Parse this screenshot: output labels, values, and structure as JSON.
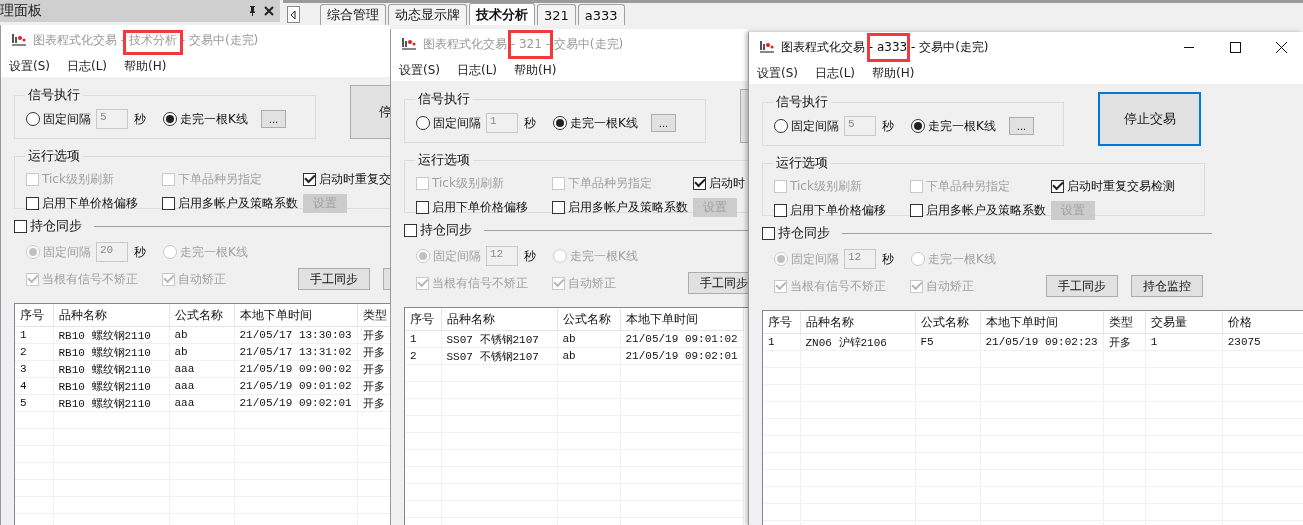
{
  "panel": {
    "title": "理面板"
  },
  "tabs": [
    {
      "label": "综合管理",
      "selected": false
    },
    {
      "label": "动态显示牌",
      "selected": false
    },
    {
      "label": "技术分析",
      "selected": true
    },
    {
      "label": "321",
      "selected": false
    },
    {
      "label": "a333",
      "selected": false
    }
  ],
  "windows": [
    {
      "active": false,
      "title": "图表程式化交易 - 技术分析 - 交易中(走完)",
      "highlighted": true,
      "menu": [
        "设置(S)",
        "日志(L)",
        "帮助(H)"
      ],
      "signal": {
        "title": "信号执行",
        "options": [
          {
            "label": "固定间隔",
            "selected": false
          },
          {
            "label": "走完一根K线",
            "selected": true
          }
        ],
        "interval": "5",
        "unit": "秒",
        "more_button": "..."
      },
      "stop_button": {
        "kind": "labeled",
        "label": "停"
      },
      "run_options": {
        "title": "运行选项",
        "items": [
          {
            "label": "Tick级别刷新",
            "checked": false,
            "disabled": true
          },
          {
            "label": "下单品种另指定",
            "checked": false,
            "disabled": true
          },
          {
            "label": "启动时重复交",
            "checked": true,
            "disabled": false
          },
          {
            "label": "启用下单价格偏移",
            "checked": false,
            "disabled": false
          },
          {
            "label": "启用多帐户及策略系数",
            "checked": false,
            "disabled": false
          }
        ],
        "settings_button": "设置"
      },
      "sync": {
        "label": "持仓同步",
        "checked": false,
        "options": [
          {
            "label": "固定间隔",
            "selected": true,
            "disabled": true
          },
          {
            "label": "走完一根K线",
            "selected": false,
            "disabled": true
          }
        ],
        "interval": "20",
        "unit": "秒",
        "checks": [
          {
            "label": "当根有信号不矫正",
            "checked": true,
            "disabled": true
          },
          {
            "label": "自动矫正",
            "checked": true,
            "disabled": true
          }
        ],
        "buttons": [
          {
            "kind": "labeled",
            "label": "手工同步"
          },
          {
            "kind": "edge"
          }
        ]
      },
      "table": {
        "columns": [
          "序号",
          "品种名称",
          "公式名称",
          "本地下单时间",
          "类型"
        ],
        "rows": [
          [
            "1",
            "RB10 螺纹钢2110",
            "ab",
            "21/05/17 13:30:03",
            "开多"
          ],
          [
            "2",
            "RB10 螺纹钢2110",
            "ab",
            "21/05/17 13:31:02",
            "开多"
          ],
          [
            "3",
            "RB10 螺纹钢2110",
            "aaa",
            "21/05/19 09:00:02",
            "开多"
          ],
          [
            "4",
            "RB10 螺纹钢2110",
            "aaa",
            "21/05/19 09:01:02",
            "开多"
          ],
          [
            "5",
            "RB10 螺纹钢2110",
            "aaa",
            "21/05/19 09:02:01",
            "开多"
          ]
        ]
      }
    },
    {
      "active": false,
      "title": "图表程式化交易 - 321 - 交易中(走完)",
      "highlighted": true,
      "menu": [
        "设置(S)",
        "日志(L)",
        "帮助(H)"
      ],
      "signal": {
        "title": "信号执行",
        "options": [
          {
            "label": "固定间隔",
            "selected": false
          },
          {
            "label": "走完一根K线",
            "selected": true
          }
        ],
        "interval": "1",
        "unit": "秒",
        "more_button": "..."
      },
      "stop_button": {
        "kind": "edge"
      },
      "run_options": {
        "title": "运行选项",
        "items": [
          {
            "label": "Tick级别刷新",
            "checked": false,
            "disabled": true
          },
          {
            "label": "下单品种另指定",
            "checked": false,
            "disabled": true
          },
          {
            "label": "启动时",
            "checked": true,
            "disabled": false
          },
          {
            "label": "启用下单价格偏移",
            "checked": false,
            "disabled": false
          },
          {
            "label": "启用多帐户及策略系数",
            "checked": false,
            "disabled": false
          }
        ],
        "settings_button": "设置"
      },
      "sync": {
        "label": "持仓同步",
        "checked": false,
        "options": [
          {
            "label": "固定间隔",
            "selected": true,
            "disabled": true
          },
          {
            "label": "走完一根K线",
            "selected": false,
            "disabled": true
          }
        ],
        "interval": "12",
        "unit": "秒",
        "checks": [
          {
            "label": "当根有信号不矫正",
            "checked": true,
            "disabled": true
          },
          {
            "label": "自动矫正",
            "checked": true,
            "disabled": true
          }
        ],
        "buttons": [
          {
            "kind": "labeled",
            "label": "手工同步"
          }
        ]
      },
      "table": {
        "columns": [
          "序号",
          "品种名称",
          "公式名称",
          "本地下单时间"
        ],
        "rows": [
          [
            "1",
            "SS07 不锈钢2107",
            "ab",
            "21/05/19 09:01:02"
          ],
          [
            "2",
            "SS07 不锈钢2107",
            "ab",
            "21/05/19 09:02:01"
          ]
        ]
      }
    },
    {
      "active": true,
      "title": "图表程式化交易 - a333 - 交易中(走完)",
      "highlighted": true,
      "menu": [
        "设置(S)",
        "日志(L)",
        "帮助(H)"
      ],
      "signal": {
        "title": "信号执行",
        "options": [
          {
            "label": "固定间隔",
            "selected": false
          },
          {
            "label": "走完一根K线",
            "selected": true
          }
        ],
        "interval": "5",
        "unit": "秒",
        "more_button": "..."
      },
      "stop_button": {
        "kind": "labeled",
        "label": "停止交易"
      },
      "run_options": {
        "title": "运行选项",
        "items": [
          {
            "label": "Tick级别刷新",
            "checked": false,
            "disabled": true
          },
          {
            "label": "下单品种另指定",
            "checked": false,
            "disabled": true
          },
          {
            "label": "启动时重复交易检测",
            "checked": true,
            "disabled": false
          },
          {
            "label": "启用下单价格偏移",
            "checked": false,
            "disabled": false
          },
          {
            "label": "启用多帐户及策略系数",
            "checked": false,
            "disabled": false
          }
        ],
        "settings_button": "设置"
      },
      "sync": {
        "label": "持仓同步",
        "checked": false,
        "options": [
          {
            "label": "固定间隔",
            "selected": true,
            "disabled": true
          },
          {
            "label": "走完一根K线",
            "selected": false,
            "disabled": true
          }
        ],
        "interval": "12",
        "unit": "秒",
        "checks": [
          {
            "label": "当根有信号不矫正",
            "checked": true,
            "disabled": true
          },
          {
            "label": "自动矫正",
            "checked": true,
            "disabled": true
          }
        ],
        "buttons": [
          {
            "kind": "labeled",
            "label": "手工同步"
          },
          {
            "kind": "labeled",
            "label": "持仓监控"
          }
        ]
      },
      "table": {
        "columns": [
          "序号",
          "品种名称",
          "公式名称",
          "本地下单时间",
          "类型",
          "交易量",
          "价格"
        ],
        "rows": [
          [
            "1",
            "ZN06 沪锌2106",
            "F5",
            "21/05/19 09:02:23",
            "开多",
            "1",
            "23075"
          ]
        ]
      }
    }
  ]
}
